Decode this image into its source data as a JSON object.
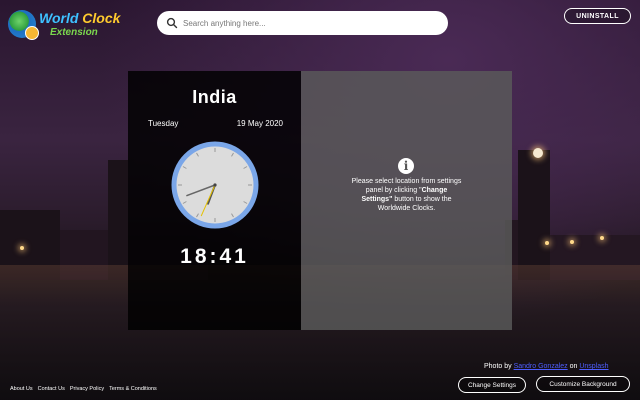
{
  "logo": {
    "line1_a": "World ",
    "line1_b": "Clock",
    "line2": "Extension"
  },
  "search": {
    "placeholder": "Search anything here..."
  },
  "header": {
    "uninstall_label": "UNINSTALL"
  },
  "clock_card": {
    "country": "India",
    "day": "Tuesday",
    "date": "19 May 2020",
    "time": "18:41",
    "analog": {
      "hour": 18,
      "minute": 41,
      "second": 34
    }
  },
  "info_card": {
    "text_before": "Please select location from settings panel by clicking \"",
    "text_bold": "Change Settings\"",
    "text_after": " button to show the Worldwide Clocks."
  },
  "credit": {
    "prefix": "Photo by ",
    "author": "Sandro Gonzalez",
    "middle": " on ",
    "site": "Unsplash"
  },
  "footer": {
    "links": [
      "About Us",
      "Contact Us",
      "Privacy Policy",
      "Terms & Conditions"
    ]
  },
  "buttons": {
    "change_settings": "Change Settings",
    "customize_background": "Customize Background"
  },
  "colors": {
    "clock_ring": "#7aa6e8",
    "clock_face": "#dcdcdc",
    "second_hand": "#e5c100"
  }
}
